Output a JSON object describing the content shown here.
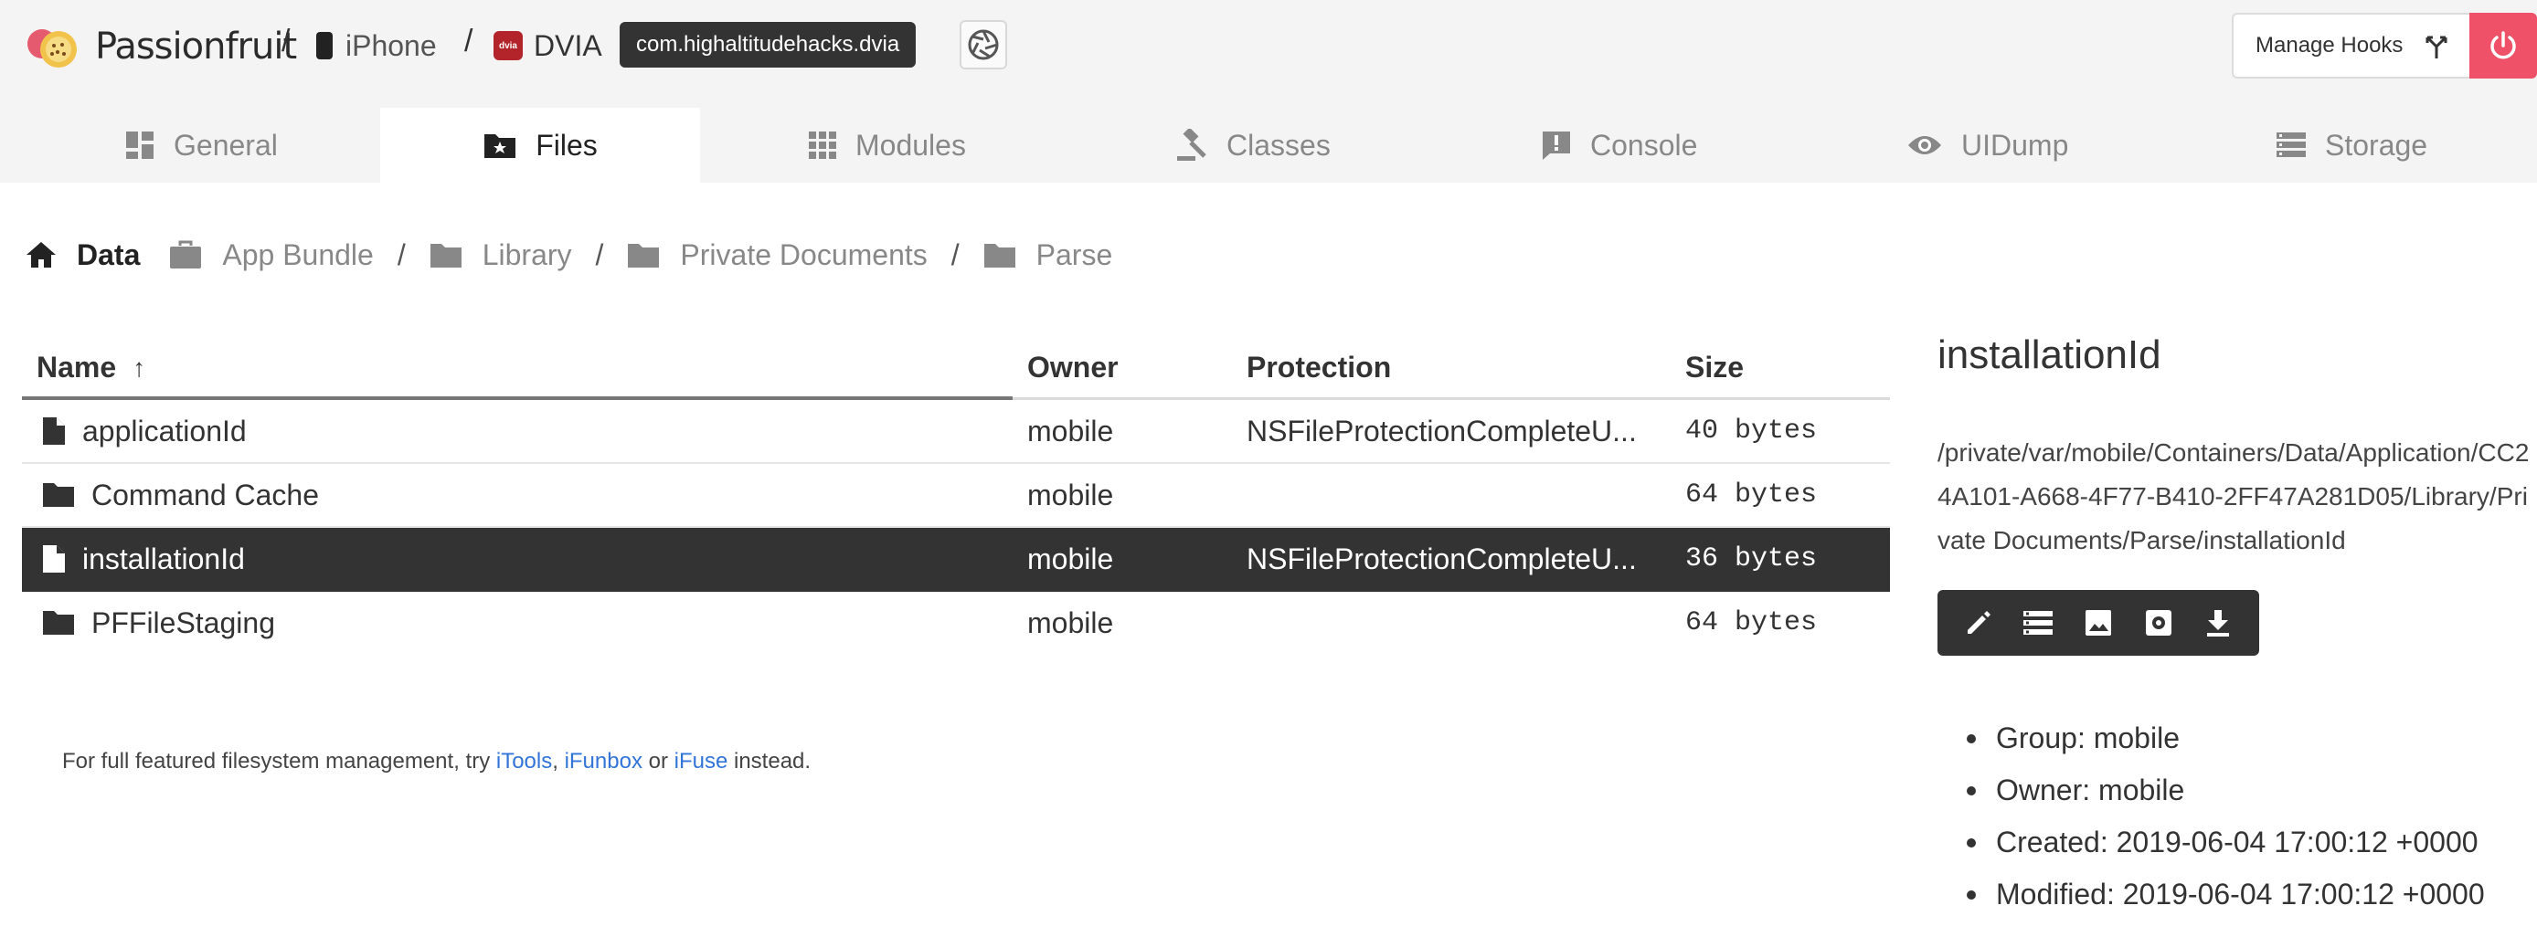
{
  "header": {
    "logo_text": "Passionfruit",
    "breadcrumb_sep": "/",
    "device_label": "iPhone",
    "app_label": "DVIA",
    "app_icon_text": "dvia",
    "bundle_id": "com.highaltitudehacks.dvia",
    "manage_hooks_label": "Manage Hooks",
    "accent_color": "#ef5168"
  },
  "tabs": [
    {
      "label": "General",
      "icon": "dashboard-icon"
    },
    {
      "label": "Files",
      "icon": "folder-star-icon",
      "active": true
    },
    {
      "label": "Modules",
      "icon": "grid-icon"
    },
    {
      "label": "Classes",
      "icon": "gavel-icon"
    },
    {
      "label": "Console",
      "icon": "alert-box-icon"
    },
    {
      "label": "UIDump",
      "icon": "eye-icon"
    },
    {
      "label": "Storage",
      "icon": "list-icon"
    }
  ],
  "breadcrumb": {
    "home": "Data",
    "items": [
      "App Bundle",
      "Library",
      "Private Documents",
      "Parse"
    ],
    "sep": "/"
  },
  "table": {
    "columns": {
      "name": "Name",
      "owner": "Owner",
      "protection": "Protection",
      "size": "Size"
    },
    "sort_indicator": "↑",
    "rows": [
      {
        "type": "file",
        "name": "applicationId",
        "owner": "mobile",
        "protection": "NSFileProtectionCompleteU...",
        "size": "40 bytes"
      },
      {
        "type": "folder",
        "name": "Command Cache",
        "owner": "mobile",
        "protection": "",
        "size": "64 bytes"
      },
      {
        "type": "file",
        "name": "installationId",
        "owner": "mobile",
        "protection": "NSFileProtectionCompleteU...",
        "size": "36 bytes",
        "selected": true
      },
      {
        "type": "folder",
        "name": "PFFileStaging",
        "owner": "mobile",
        "protection": "",
        "size": "64 bytes"
      }
    ]
  },
  "footnote": {
    "prefix": "For full featured filesystem management, try ",
    "link1": "iTools",
    "sep1": ", ",
    "link2": "iFunbox",
    "sep2": " or ",
    "link3": "iFuse",
    "suffix": " instead."
  },
  "detail": {
    "title": "installationId",
    "path": "/private/var/mobile/Containers/Data/Application/CC24A101-A668-4F77-B410-2FF47A281D05/Library/Private Documents/Parse/installationId",
    "actions": [
      "edit-icon",
      "list-view-icon",
      "image-icon",
      "settings-icon",
      "download-icon"
    ],
    "meta": [
      "Group: mobile",
      "Owner: mobile",
      "Created: 2019-06-04 17:00:12 +0000",
      "Modified: 2019-06-04 17:00:12 +0000"
    ]
  }
}
